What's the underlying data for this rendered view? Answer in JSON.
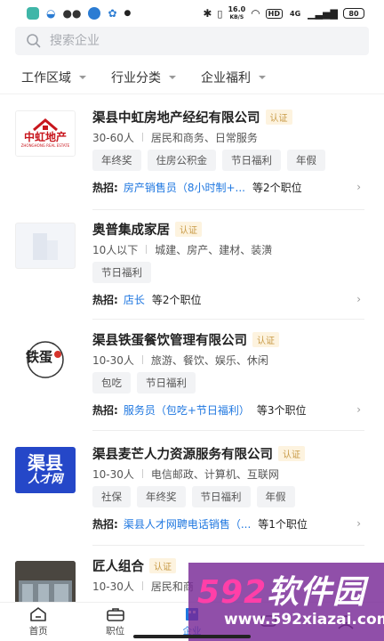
{
  "status_bar": {
    "speed_value": "16.0",
    "speed_unit": "KB/S",
    "hd": "HD",
    "network": "4G",
    "battery": "80"
  },
  "search": {
    "placeholder": "搜索企业"
  },
  "filters": [
    {
      "label": "工作区域"
    },
    {
      "label": "行业分类"
    },
    {
      "label": "企业福利"
    }
  ],
  "companies": [
    {
      "name": "渠县中虹房地产经纪有限公司",
      "cert": "认证",
      "logo_text": "中虹地产",
      "logo_sub": "ZHONGHONG REAL ESTATE",
      "size": "30-60人",
      "industry": "居民和商务、日常服务",
      "tags": [
        "年终奖",
        "住房公积金",
        "节日福利",
        "年假"
      ],
      "hot_label": "热招:",
      "hot_job": "房产销售员（8小时制+...",
      "hot_more": "等2个职位"
    },
    {
      "name": "奥普集成家居",
      "cert": "认证",
      "size": "10人以下",
      "industry": "城建、房产、建材、装潢",
      "tags": [
        "节日福利"
      ],
      "hot_label": "热招:",
      "hot_job": "店长",
      "hot_more": "等2个职位"
    },
    {
      "name": "渠县铁蛋餐饮管理有限公司",
      "cert": "认证",
      "logo_text": "铁蛋",
      "size": "10-30人",
      "industry": "旅游、餐饮、娱乐、休闲",
      "tags": [
        "包吃",
        "节日福利"
      ],
      "hot_label": "热招:",
      "hot_job": "服务员（包吃+节日福利）",
      "hot_more": "等3个职位"
    },
    {
      "name": "渠县麦芒人力资源服务有限公司",
      "cert": "认证",
      "logo_text": "渠县",
      "logo_sub": "人才网",
      "size": "10-30人",
      "industry": "电信邮政、计算机、互联网",
      "tags": [
        "社保",
        "年终奖",
        "节日福利",
        "年假"
      ],
      "hot_label": "热招:",
      "hot_job": "渠县人才网聘电话销售（...",
      "hot_more": "等1个职位"
    },
    {
      "name": "匠人组合",
      "cert": "认证",
      "size": "10-30人",
      "industry": "居民和商"
    }
  ],
  "tabs": [
    {
      "label": "首页",
      "icon": "home-icon"
    },
    {
      "label": "职位",
      "icon": "briefcase-icon"
    },
    {
      "label": "企业",
      "icon": "building-icon"
    },
    {
      "label": "",
      "icon": "message-icon"
    },
    {
      "label": "",
      "icon": "user-icon"
    }
  ],
  "watermark": {
    "brand_num": "592",
    "brand_text": "软件园",
    "url": "www.592xiazai.com"
  },
  "colors": {
    "accent": "#1f77e0",
    "cert_text": "#c89a46",
    "cert_bg": "#fdf3df",
    "tag_bg": "#f2f3f5"
  }
}
